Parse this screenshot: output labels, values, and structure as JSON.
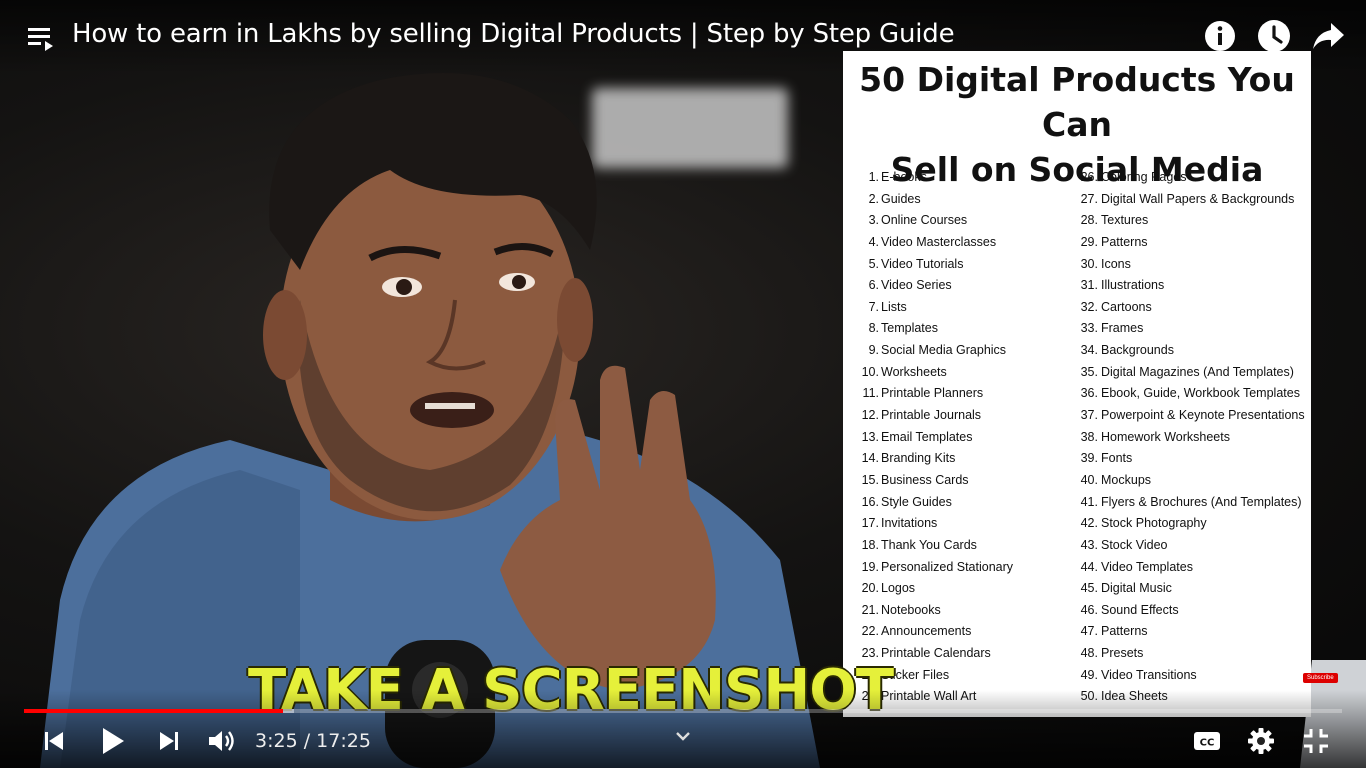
{
  "header": {
    "title": "How to earn in Lakhs by selling Digital Products | Step by Step Guide"
  },
  "icons": {
    "playlist": "playlist-icon",
    "info": "info-icon",
    "watch_later": "clock-icon",
    "share": "share-icon"
  },
  "overlay": {
    "title_line1": "50 Digital Products You Can",
    "title_line2": "Sell on Social Media",
    "left_items": [
      {
        "num": "1.",
        "label": "E-books"
      },
      {
        "num": "2.",
        "label": "Guides"
      },
      {
        "num": "3.",
        "label": "Online Courses"
      },
      {
        "num": "4.",
        "label": "Video Masterclasses"
      },
      {
        "num": "5.",
        "label": "Video Tutorials"
      },
      {
        "num": "6.",
        "label": "Video Series"
      },
      {
        "num": "7.",
        "label": "Lists"
      },
      {
        "num": "8.",
        "label": "Templates"
      },
      {
        "num": "9.",
        "label": "Social Media Graphics"
      },
      {
        "num": "10.",
        "label": "Worksheets"
      },
      {
        "num": "11.",
        "label": "Printable Planners"
      },
      {
        "num": "12.",
        "label": "Printable Journals"
      },
      {
        "num": "13.",
        "label": "Email Templates"
      },
      {
        "num": "14.",
        "label": "Branding Kits"
      },
      {
        "num": "15.",
        "label": "Business Cards"
      },
      {
        "num": "16.",
        "label": "Style Guides"
      },
      {
        "num": "17.",
        "label": "Invitations"
      },
      {
        "num": "18.",
        "label": "Thank You Cards"
      },
      {
        "num": "19.",
        "label": "Personalized Stationary"
      },
      {
        "num": "20.",
        "label": "Logos"
      },
      {
        "num": "21.",
        "label": "Notebooks"
      },
      {
        "num": "22.",
        "label": "Announcements"
      },
      {
        "num": "23.",
        "label": "Printable Calendars"
      },
      {
        "num": "24.",
        "label": "Sticker Files"
      },
      {
        "num": "25.",
        "label": "Printable Wall Art"
      }
    ],
    "right_items": [
      {
        "num": "26.",
        "label": "Coloring Pages"
      },
      {
        "num": "27.",
        "label": "Digital Wall Papers & Backgrounds"
      },
      {
        "num": "28.",
        "label": "Textures"
      },
      {
        "num": "29.",
        "label": "Patterns"
      },
      {
        "num": "30.",
        "label": "Icons"
      },
      {
        "num": "31.",
        "label": "Illustrations"
      },
      {
        "num": "32.",
        "label": "Cartoons"
      },
      {
        "num": "33.",
        "label": "Frames"
      },
      {
        "num": "34.",
        "label": "Backgrounds"
      },
      {
        "num": "35.",
        "label": "Digital Magazines (And Templates)"
      },
      {
        "num": "36.",
        "label": "Ebook, Guide, Workbook Templates"
      },
      {
        "num": "37.",
        "label": "Powerpoint & Keynote Presentations"
      },
      {
        "num": "38.",
        "label": "Homework Worksheets"
      },
      {
        "num": "39.",
        "label": "Fonts"
      },
      {
        "num": "40.",
        "label": "Mockups"
      },
      {
        "num": "41.",
        "label": "Flyers & Brochures (And Templates)"
      },
      {
        "num": "42.",
        "label": "Stock Photography"
      },
      {
        "num": "43.",
        "label": "Stock Video"
      },
      {
        "num": "44.",
        "label": "Video Templates"
      },
      {
        "num": "45.",
        "label": "Digital Music"
      },
      {
        "num": "46.",
        "label": "Sound Effects"
      },
      {
        "num": "47.",
        "label": "Patterns"
      },
      {
        "num": "48.",
        "label": "Presets"
      },
      {
        "num": "49.",
        "label": "Video Transitions"
      },
      {
        "num": "50.",
        "label": "Idea Sheets"
      }
    ]
  },
  "caption": "TAKE A SCREENSHOT",
  "subscribe_badge": "Subscribe",
  "player": {
    "current_time": "3:25",
    "duration": "17:25",
    "time_display": "3:25 / 17:25",
    "played_fraction": 0.1966,
    "buffered_fraction": 0.205,
    "progress_color": "#ff0000",
    "caption_color": "#e5f03a",
    "controls": {
      "prev": "previous-icon",
      "play": "play-icon",
      "next": "next-icon",
      "volume": "volume-icon",
      "chevron": "chevron-down-icon",
      "cc": "closed-captions-icon",
      "settings": "gear-icon",
      "exit_fullscreen": "exit-fullscreen-icon"
    }
  }
}
